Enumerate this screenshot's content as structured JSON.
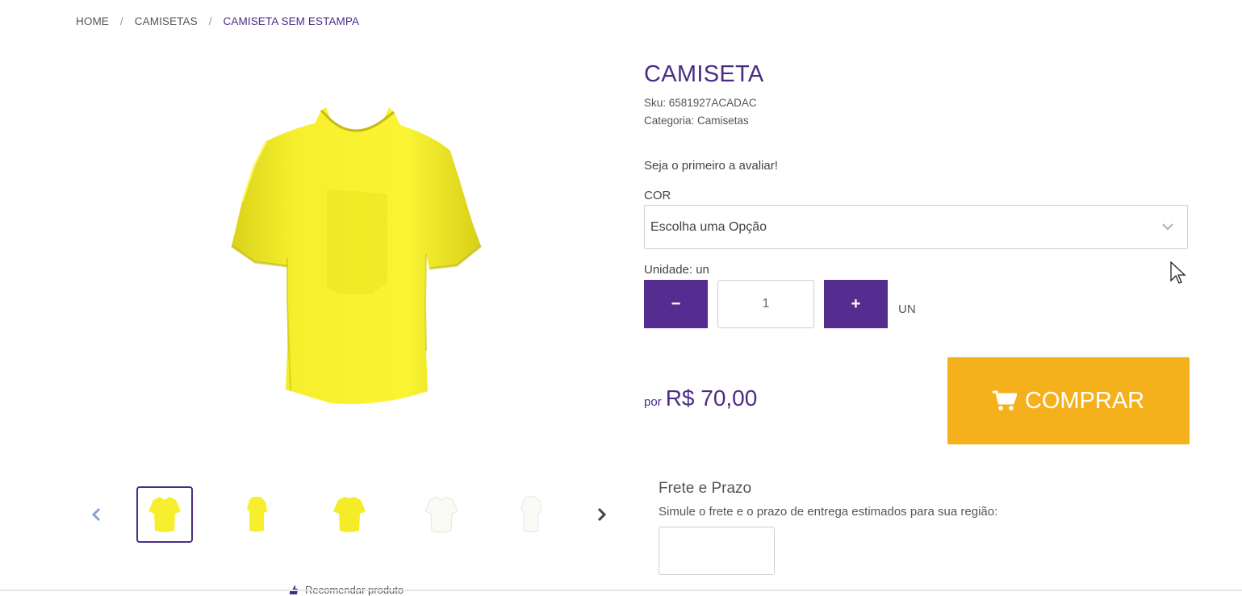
{
  "breadcrumb": {
    "home": "HOME",
    "category": "CAMISETAS",
    "current": "CAMISETA SEM ESTAMPA",
    "separator": "/"
  },
  "product": {
    "title": "CAMISETA",
    "sku": "Sku: 6581927ACADAC",
    "category": "Categoria: Camisetas",
    "rating_text": "Seja o primeiro a avaliar!",
    "color_label": "COR",
    "color_select": "Escolha uma Opção",
    "unit_label": "Unidade: un",
    "quantity": "1",
    "minus_label": "−",
    "plus_label": "+",
    "unit": "UN",
    "price_prefix": "por",
    "price": "R$ 70,00",
    "buy_label": "COMPRAR"
  },
  "shipping": {
    "title": "Frete e Prazo",
    "description": "Simule o frete e o prazo de entrega estimados para sua região:"
  },
  "gallery": {
    "thumbs": [
      "yellow-front",
      "yellow-side",
      "yellow-back",
      "white-front",
      "white-side"
    ],
    "recommend": "Recomendar produto"
  },
  "colors": {
    "accent": "#4b2c85",
    "button": "#552d91",
    "buy": "#f5b11c",
    "shirt_yellow": "#f6ee2a",
    "shirt_white": "#f8f8f8"
  }
}
